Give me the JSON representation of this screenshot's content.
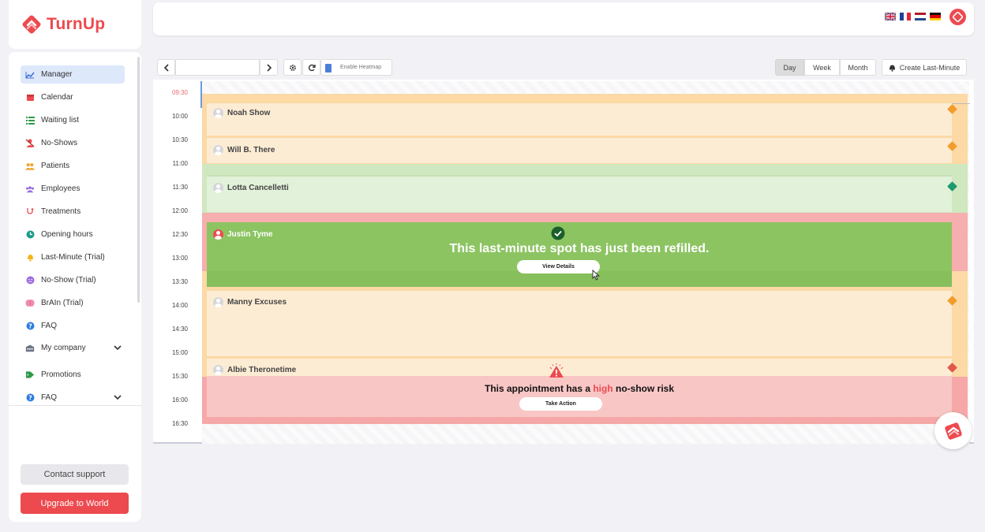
{
  "app": {
    "name": "TurnUp"
  },
  "sidebar": {
    "items": [
      {
        "label": "Manager",
        "icon": "chart-line-icon",
        "active": true
      },
      {
        "label": "Calendar",
        "icon": "calendar-icon"
      },
      {
        "label": "Waiting list",
        "icon": "list-icon"
      },
      {
        "label": "No-Shows",
        "icon": "user-slash-icon"
      },
      {
        "label": "Patients",
        "icon": "users-icon"
      },
      {
        "label": "Employees",
        "icon": "employees-icon"
      },
      {
        "label": "Treatments",
        "icon": "stethoscope-icon"
      },
      {
        "label": "Opening hours",
        "icon": "clock-icon"
      },
      {
        "label": "Last-Minute (Trial)",
        "icon": "bell-icon"
      },
      {
        "label": "No-Show (Trial)",
        "icon": "face-icon"
      },
      {
        "label": "BrAIn (Trial)",
        "icon": "brain-icon"
      },
      {
        "label": "FAQ",
        "icon": "question-icon"
      },
      {
        "label": "My company",
        "icon": "building-icon",
        "expandable": true
      },
      {
        "label": "Promotions",
        "icon": "tag-icon"
      },
      {
        "label": "FAQ",
        "icon": "question-icon",
        "expandable": true
      }
    ],
    "contact_label": "Contact support",
    "upgrade_label": "Upgrade to World"
  },
  "topbar": {
    "languages": [
      "en-flag-icon",
      "fr-flag-icon",
      "nl-flag-icon",
      "de-flag-icon"
    ]
  },
  "toolbar": {
    "heatmap_label": "Enable Heatmap",
    "views": [
      "Day",
      "Week",
      "Month"
    ],
    "active_view": "Day",
    "create_label": "Create Last-Minute"
  },
  "calendar": {
    "times": [
      "09:30",
      "10:00",
      "10:30",
      "11:00",
      "11:30",
      "12:00",
      "12:30",
      "13:00",
      "13:30",
      "14:00",
      "14:30",
      "15:00",
      "15:30",
      "16:00",
      "16:30"
    ],
    "appointments": [
      {
        "name": "Noah Show",
        "status": "medium"
      },
      {
        "name": "Will B. There",
        "status": "medium"
      },
      {
        "name": "Lotta Cancelletti",
        "status": "low"
      },
      {
        "name": "Justin Tyme",
        "status": "refilled"
      },
      {
        "name": "Manny Excuses",
        "status": "medium"
      },
      {
        "name": "Albie Theronetime",
        "status": "high"
      }
    ],
    "refill_message": "This last-minute spot has just been refilled.",
    "view_details_label": "View Details",
    "risk_prefix": "This appointment has a ",
    "risk_level": "high",
    "risk_suffix": " no-show risk",
    "take_action_label": "Take Action"
  },
  "colors": {
    "brand": "#ec4a4f",
    "orange_band": "#fde7c4",
    "green_band": "#dcefd0",
    "red_band": "#f9c6c6",
    "refill_green": "#8cc462"
  }
}
